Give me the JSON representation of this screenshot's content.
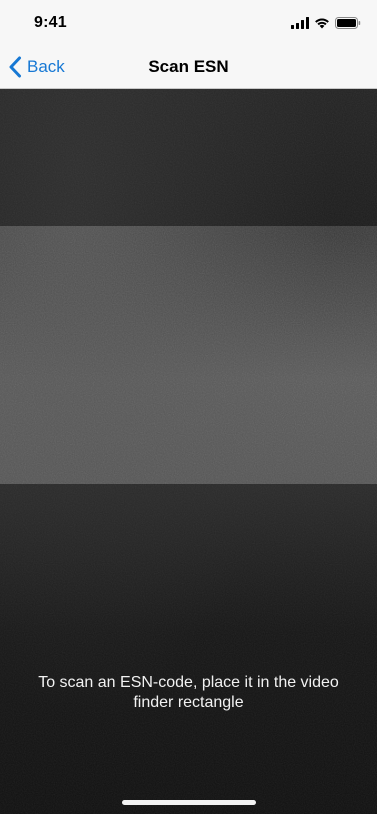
{
  "status_bar": {
    "time": "9:41",
    "icons": [
      "cellular-signal-icon",
      "wifi-icon",
      "battery-icon"
    ]
  },
  "nav": {
    "back_label": "Back",
    "title": "Scan ESN"
  },
  "scanner": {
    "hint": "To scan an ESN-code, place it in the video finder rectangle"
  },
  "colors": {
    "accent": "#1778d4",
    "bar_background": "#f7f7f7"
  }
}
